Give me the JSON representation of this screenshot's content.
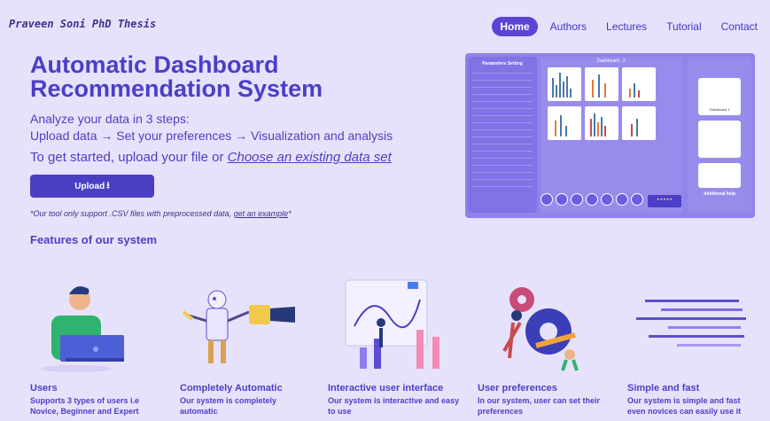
{
  "brand": "Praveen Soni PhD Thesis",
  "nav": {
    "home": "Home",
    "authors": "Authors",
    "lectures": "Lectures",
    "tutorial": "Tutorial",
    "contact": "Contact"
  },
  "hero": {
    "title": "Automatic Dashboard Recommendation System",
    "steps_line1": "Analyze your data in 3 steps:",
    "steps_line2": "Upload data → Set your preferences → Visualization and analysis",
    "start_prefix": "To get started, upload your file or ",
    "start_link": "Choose an existing data set",
    "upload_button": "Upload",
    "upload_icon": "⭳",
    "note_prefix": "*Our tool only support .CSV files with preprocessed data, ",
    "note_link": "get an example",
    "note_suffix": "*"
  },
  "preview": {
    "left_title": "Parameters Setting",
    "center_title": "Dashboard - 2",
    "right_card_label": "Dashboard 1",
    "help_label": "Additional help",
    "rating_label": "★★★★★"
  },
  "features_title": "Features of our system",
  "features": [
    {
      "title": "Users",
      "desc": "Supports 3 types of users i.e Novice, Beginner and Expert"
    },
    {
      "title": "Completely Automatic",
      "desc": "Our system is completely automatic"
    },
    {
      "title": "Interactive user interface",
      "desc": "Our system is interactive and easy to use"
    },
    {
      "title": "User preferences",
      "desc": "In our system, user can set their preferences"
    },
    {
      "title": "Simple and fast",
      "desc": "Our system is simple and fast even novices can easily use it"
    }
  ],
  "colors": {
    "background": "#e7e2fb",
    "accent": "#4b3fc7",
    "button": "#4a3fc2",
    "preview_bg": "#8f84ea"
  }
}
